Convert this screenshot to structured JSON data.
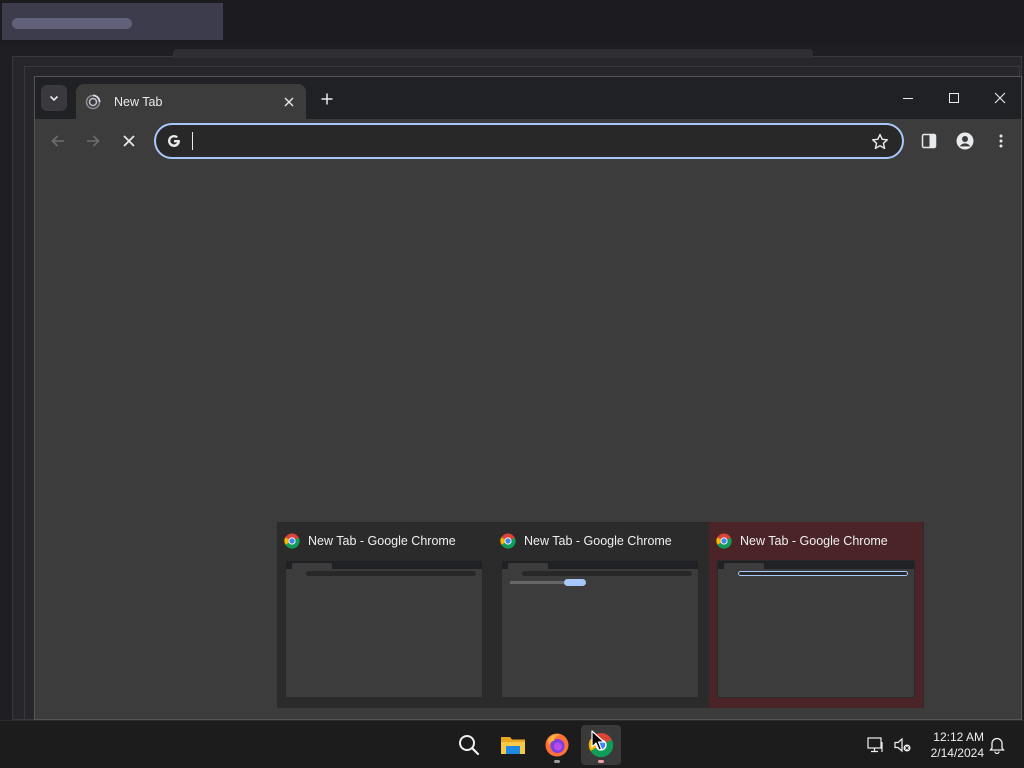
{
  "browser": {
    "tab": {
      "title": "New Tab",
      "close_label": "×"
    },
    "new_tab_label": "+",
    "omnibox": {
      "value": "",
      "placeholder": ""
    },
    "window_controls": [
      "minimize",
      "maximize",
      "close"
    ]
  },
  "previews": [
    {
      "title": "New Tab - Google Chrome",
      "active": false
    },
    {
      "title": "New Tab - Google Chrome",
      "active": false
    },
    {
      "title": "New Tab - Google Chrome",
      "active": true
    }
  ],
  "taskbar": {
    "apps": [
      "search-icon",
      "file-explorer-icon",
      "firefox-icon",
      "chrome-icon"
    ],
    "clock": {
      "time": "12:12 AM",
      "date": "2/14/2024"
    }
  },
  "colors": {
    "accent": "#a8c7fa",
    "active_preview": "#4a2427",
    "window_bg": "#3c3c3c",
    "tabbar_bg": "#202124"
  }
}
